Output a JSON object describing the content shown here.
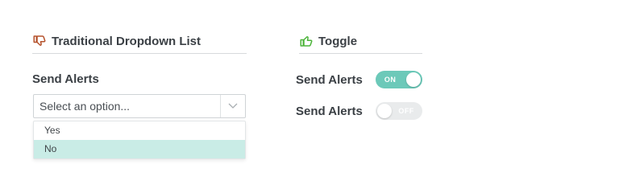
{
  "left_section": {
    "title": "Traditional Dropdown List",
    "icon": "thumbs-down-icon",
    "icon_color": "#b5522c",
    "field_label": "Send Alerts",
    "select": {
      "placeholder": "Select an option...",
      "options": [
        "Yes",
        "No"
      ],
      "highlighted_option": "No"
    }
  },
  "right_section": {
    "title": "Toggle",
    "icon": "thumbs-up-icon",
    "icon_color": "#4cb43a",
    "toggles": [
      {
        "label": "Send Alerts",
        "state": "ON"
      },
      {
        "label": "Send Alerts",
        "state": "OFF"
      }
    ]
  },
  "colors": {
    "toggle_on": "#6cc9b9",
    "toggle_off": "#e9ebec",
    "option_highlight": "#c9ece6"
  }
}
